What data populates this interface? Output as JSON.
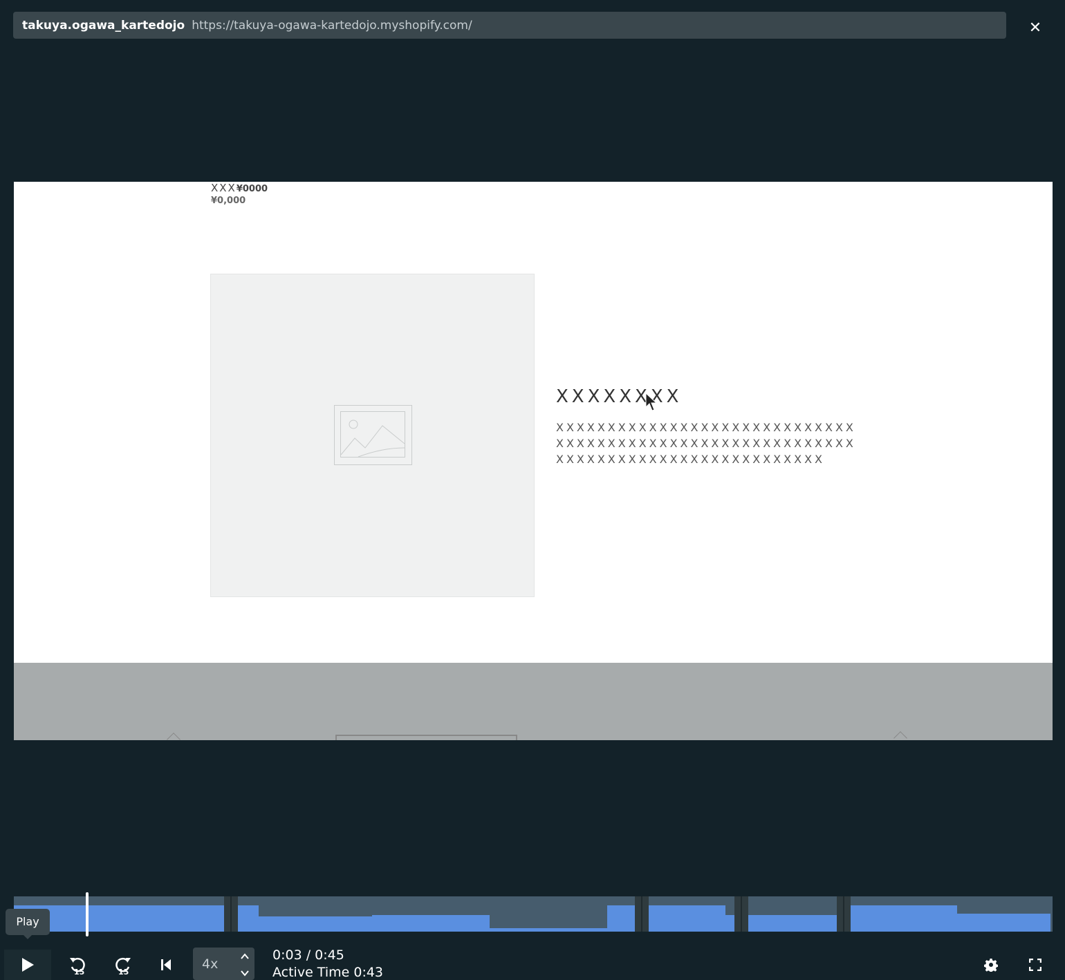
{
  "urlbar": {
    "site": "takuya.ogawa_kartedojo",
    "url": "https://takuya-ogawa-kartedojo.myshopify.com/"
  },
  "page": {
    "product_name_prefix": "XXX",
    "product_name_price": "¥0000",
    "price": "¥0,000",
    "product_title": "XXXXXXXX",
    "product_description": "XXXXXXXXXXXXXXXXXXXXXXXXXXXXXXXXXXXXXXXXXXXXXXXXXXXXXXXXXXXXXXXXXXXXXXXXXXXXXXXXXXXX"
  },
  "player": {
    "tooltip": "Play",
    "speed": "4x",
    "time": "0:03 / 0:45",
    "active_time": "Active Time 0:43",
    "progress_fraction": 0.067
  },
  "colors": {
    "background": "#132229",
    "timeline": "#465c6d",
    "activity": "#5a8fe0"
  }
}
